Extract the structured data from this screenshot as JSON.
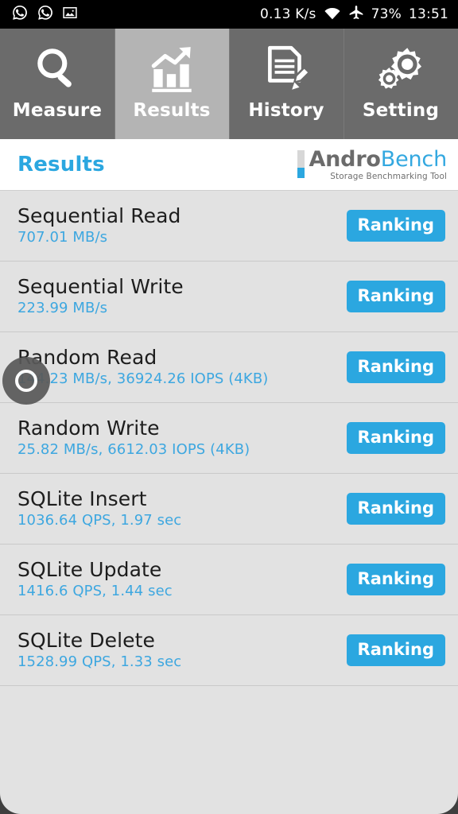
{
  "statusbar": {
    "icons_left": [
      "whatsapp-icon",
      "whatsapp-icon",
      "image-icon"
    ],
    "network_speed": "0.13 K/s",
    "icons_right": [
      "wifi-icon",
      "airplane-mode-icon"
    ],
    "battery": "73%",
    "clock": "13:51"
  },
  "tabs": [
    {
      "label": "Measure",
      "icon": "search-icon",
      "selected": false
    },
    {
      "label": "Results",
      "icon": "bar-chart-icon",
      "selected": true
    },
    {
      "label": "History",
      "icon": "document-pencil-icon",
      "selected": false
    },
    {
      "label": "Setting",
      "icon": "gears-icon",
      "selected": false
    }
  ],
  "header": {
    "title": "Results",
    "brand_first": "Andro",
    "brand_second": "Bench",
    "brand_tagline": "Storage Benchmarking Tool"
  },
  "results": [
    {
      "name": "Sequential Read",
      "value": "707.01 MB/s",
      "button": "Ranking"
    },
    {
      "name": "Sequential Write",
      "value": "223.99 MB/s",
      "button": "Ranking"
    },
    {
      "name": "Random Read",
      "value": "144.23 MB/s, 36924.26 IOPS (4KB)",
      "button": "Ranking"
    },
    {
      "name": "Random Write",
      "value": "25.82 MB/s, 6612.03 IOPS (4KB)",
      "button": "Ranking"
    },
    {
      "name": "SQLite Insert",
      "value": "1036.64 QPS, 1.97 sec",
      "button": "Ranking"
    },
    {
      "name": "SQLite Update",
      "value": "1416.6 QPS, 1.44 sec",
      "button": "Ranking"
    },
    {
      "name": "SQLite Delete",
      "value": "1528.99 QPS, 1.33 sec",
      "button": "Ranking"
    }
  ],
  "overlay": {
    "touch_indicator": "touch-point-indicator"
  },
  "colors": {
    "accent_blue": "#2ba7e0",
    "status_bar": "#000000",
    "tab_bar": "#6b6b6b",
    "tab_selected": "#b4b4b4",
    "list_bg": "#e2e2e2"
  }
}
